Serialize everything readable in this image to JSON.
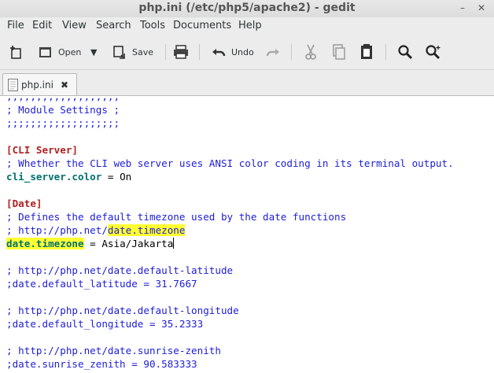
{
  "window": {
    "title": "php.ini (/etc/php5/apache2) - gedit",
    "buttons": {
      "minimize": "–",
      "close": "✕"
    }
  },
  "menubar": {
    "items": [
      "File",
      "Edit",
      "View",
      "Search",
      "Tools",
      "Documents",
      "Help"
    ]
  },
  "toolbar": {
    "new_icon": "new-document-icon",
    "open_label": "Open",
    "open_dropdown_icon": "▼",
    "save_label": "Save",
    "print_icon": "print-icon",
    "undo_label": "Undo",
    "redo_icon": "redo-icon",
    "cut_icon": "cut-icon",
    "copy_icon": "copy-icon",
    "paste_icon": "paste-icon",
    "find_icon": "search-icon",
    "replace_icon": "search-replace-icon"
  },
  "tabs": [
    {
      "label": "php.ini",
      "close_icon": "✖"
    }
  ],
  "editor": {
    "lines": {
      "l0": ";;;;;;;;;;;;;;;;;;;",
      "l1": "; Module Settings ;",
      "l2": ";;;;;;;;;;;;;;;;;;;",
      "l4": "[CLI Server]",
      "l5": "; Whether the CLI web server uses ANSI color coding in its terminal output.",
      "l6_key": "cli_server.color",
      "l6_rest": " = On",
      "l8": "[Date]",
      "l9": "; Defines the default timezone used by the date functions",
      "l10_pre": "; http://php.net/",
      "l10_hl": "date.timezone",
      "l11_key": "date.timezone",
      "l11_rest": " = Asia/Jakarta",
      "l13": "; http://php.net/date.default-latitude",
      "l14": ";date.default_latitude = 31.7667",
      "l16": "; http://php.net/date.default-longitude",
      "l17": ";date.default_longitude = 35.2333",
      "l19": "; http://php.net/date.sunrise-zenith",
      "l20": ";date.sunrise_zenith = 90.583333"
    }
  }
}
